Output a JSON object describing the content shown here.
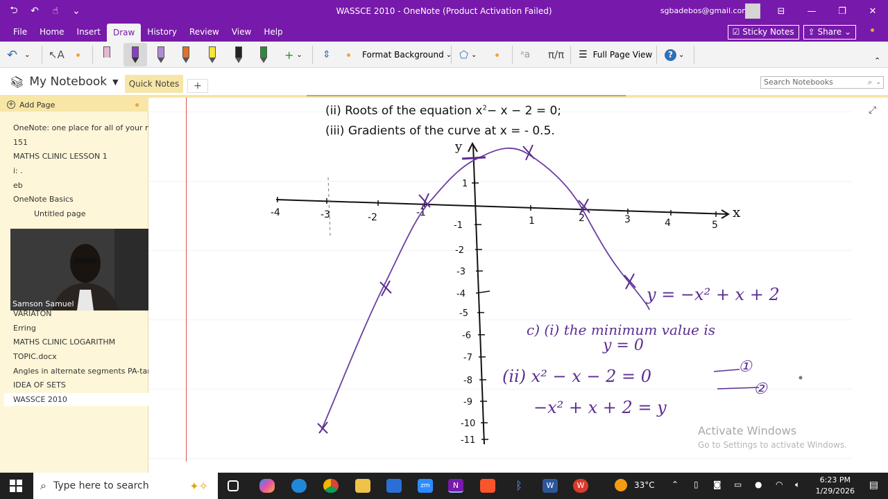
{
  "window": {
    "title": "WASSCE 2010  -  OneNote (Product Activation Failed)",
    "email": "sgbadebos@gmail.com"
  },
  "menu": {
    "tabs": [
      "File",
      "Home",
      "Insert",
      "Draw",
      "History",
      "Review",
      "View",
      "Help"
    ],
    "active_tab": "Draw",
    "sticky_notes": "Sticky Notes",
    "share": "Share"
  },
  "ribbon": {
    "format_background": "Format Background",
    "full_page_view": "Full Page View",
    "pen_colors": [
      "#b18ad4",
      "#e0722a",
      "#f6e53a",
      "#222222",
      "#2e8b3a"
    ]
  },
  "nav": {
    "notebook": "My Notebook",
    "section_tab": "Quick Notes",
    "search_placeholder": "Search Notebooks"
  },
  "sidebar": {
    "add_page": "Add Page",
    "pages": [
      "OneNote: one place for all of your no",
      "151",
      "MATHS CLINIC LESSON 1",
      "i: .",
      "eb",
      "OneNote Basics",
      "Untitled page",
      "VARIATON",
      "Erring",
      "MATHS CLINIC LOGARITHM",
      "TOPIC.docx",
      "Angles in alternate segments PA-tan",
      "IDEA OF SETS",
      "WASSCE 2010"
    ],
    "webcam_name": "Samson Samuel"
  },
  "content": {
    "line_ii_pre": "(ii) Roots of the equation x",
    "line_ii_sup": "2",
    "line_ii_post": "− x − 2 = 0;",
    "line_iii": "(iii) Gradients of the curve at x = - 0.5.",
    "x_ticks": [
      "-4",
      "-3",
      "-2",
      "-1",
      "1",
      "2",
      "3",
      "4",
      "5"
    ],
    "y_ticks_pos": [
      "1"
    ],
    "y_ticks_neg": [
      "-1",
      "-2",
      "-3",
      "-4",
      "-5",
      "-6",
      "-7",
      "-8",
      "-9",
      "-10",
      "-11"
    ],
    "axis_x_label": "x",
    "axis_y_label": "y",
    "hw_curve_label": "y = −x² + x + 2",
    "hw_line1": "c) (i) the minimum value is",
    "hw_line2": "y = 0",
    "hw_line3": "(ii)  x² − x − 2 = 0",
    "hw_line4": "−x² + x + 2 = y",
    "hw_tag1": "①",
    "hw_tag2": "②"
  },
  "watermark": {
    "line1": "Activate Windows",
    "line2": "Go to Settings to activate Windows."
  },
  "taskbar": {
    "search_placeholder": "Type here to search",
    "temperature": "33°C",
    "time": "6:23 PM",
    "date": "1/29/2026"
  }
}
